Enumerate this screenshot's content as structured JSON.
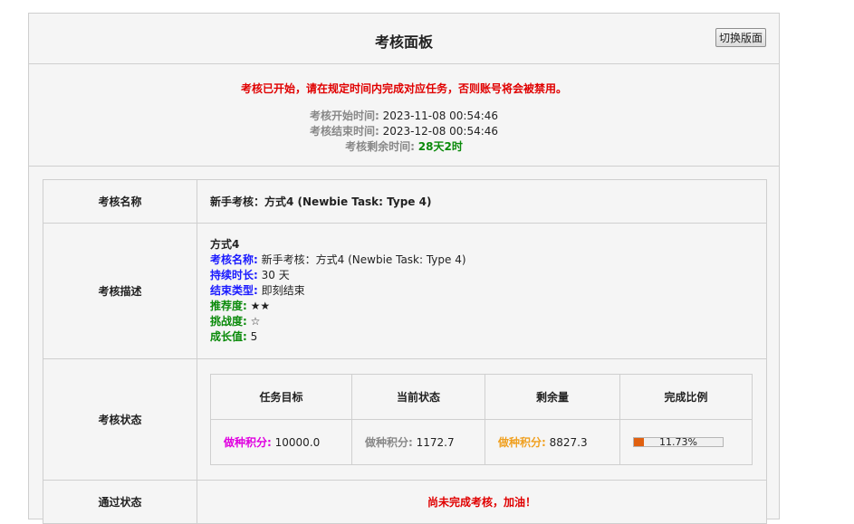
{
  "header": {
    "title": "考核面板",
    "switch_button": "切换版面"
  },
  "notice": {
    "warning": "考核已开始，请在规定时间内完成对应任务，否则账号将会被禁用。",
    "start_label": "考核开始时间:",
    "start_value": "2023-11-08 00:54:46",
    "end_label": "考核结束时间:",
    "end_value": "2023-12-08 00:54:46",
    "remain_label": "考核剩余时间:",
    "remain_value": "28天2时"
  },
  "table": {
    "name_key": "考核名称",
    "name_value": "新手考核：方式4 (Newbie Task: Type 4)",
    "desc_key": "考核描述",
    "desc": {
      "title": "方式4",
      "name_label": "考核名称:",
      "name_value": "新手考核：方式4 (Newbie Task: Type 4)",
      "duration_label": "持续时长:",
      "duration_value": "30 天",
      "end_type_label": "结束类型:",
      "end_type_value": "即刻结束",
      "recommend_label": "推荐度:",
      "recommend_value": "★★",
      "challenge_label": "挑战度:",
      "challenge_value": "☆",
      "growth_label": "成长值:",
      "growth_value": "5"
    },
    "status_key": "考核状态",
    "status_headers": [
      "任务目标",
      "当前状态",
      "剩余量",
      "完成比例"
    ],
    "status_row": {
      "target_label": "做种积分:",
      "target_value": "10000.0",
      "current_label": "做种积分:",
      "current_value": "1172.7",
      "remain_label": "做种积分:",
      "remain_value": "8827.3",
      "progress_text": "11.73%",
      "progress_fraction": 0.1173
    },
    "pass_key": "通过状态",
    "pass_value": "尚未完成考核，加油！"
  }
}
